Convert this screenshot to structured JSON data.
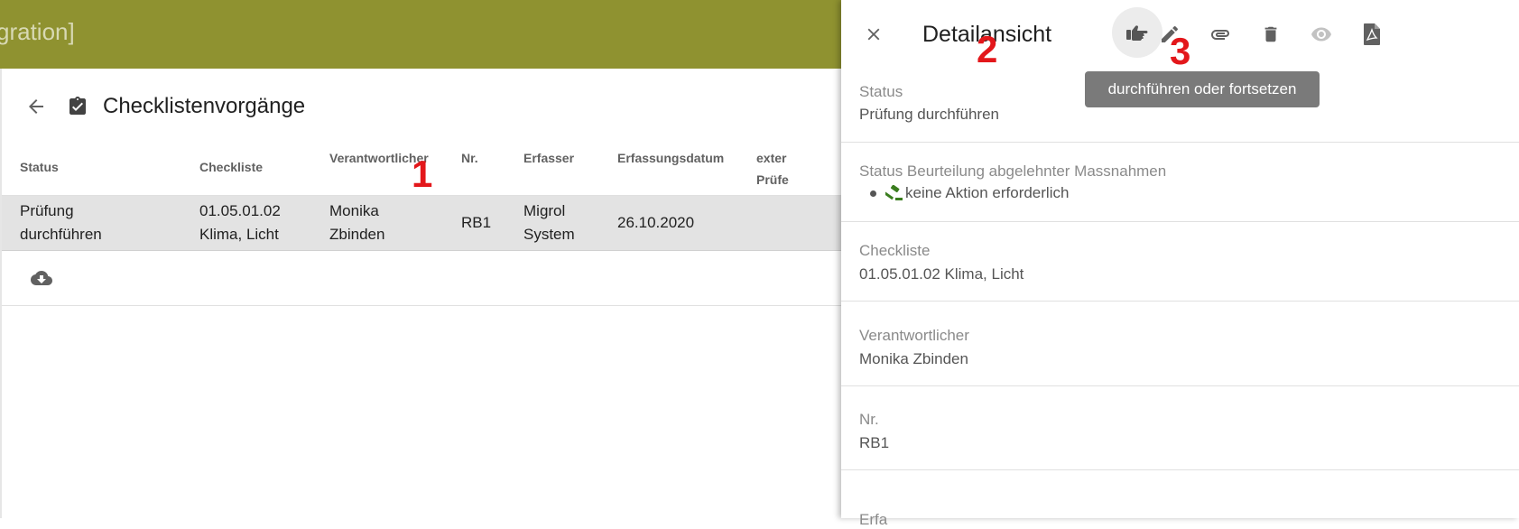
{
  "app": {
    "title_fragment": "gration]"
  },
  "page": {
    "title": "Checklistenvorgänge"
  },
  "table": {
    "headers": {
      "status": "Status",
      "checkliste": "Checkliste",
      "verantwortlicher": "Verantwortlicher",
      "nr": "Nr.",
      "erfasser": "Erfasser",
      "erfassungsdatum": "Erfassungsdatum",
      "extern_line1": "exter",
      "extern_line2": "Prüfe"
    },
    "row": {
      "status_line1": "Prüfung",
      "status_line2": "durchführen",
      "checkliste_line1": "01.05.01.02",
      "checkliste_line2": "Klima, Licht",
      "verantwortlicher_line1": "Monika",
      "verantwortlicher_line2": "Zbinden",
      "nr": "RB1",
      "erfasser_line1": "Migrol",
      "erfasser_line2": "System",
      "erfassungsdatum": "26.10.2020"
    }
  },
  "markers": {
    "m1": "1",
    "m2": "2",
    "m3": "3"
  },
  "detail": {
    "title": "Detailansicht",
    "tooltip": "durchführen oder fortsetzen",
    "status": {
      "label": "Status",
      "value": "Prüfung durchführen"
    },
    "beurteilung": {
      "label": "Status Beurteilung abgelehnter Massnahmen",
      "value": "keine Aktion erforderlich"
    },
    "checkliste": {
      "label": "Checkliste",
      "value": "01.05.01.02 Klima, Licht"
    },
    "verantwortlicher": {
      "label": "Verantwortlicher",
      "value": "Monika Zbinden"
    },
    "nr": {
      "label": "Nr.",
      "value": "RB1"
    },
    "erfasser_partial": {
      "label": "Erfa"
    }
  },
  "colors": {
    "topbar": "#8f9230",
    "marker": "#e3171b",
    "tooltip": "#7a7a7a"
  },
  "icons": [
    "arrow-back-icon",
    "clipboard-check-icon",
    "cloud-download-icon",
    "close-icon",
    "pointing-hand-icon",
    "pencil-icon",
    "paperclip-icon",
    "trash-icon",
    "eye-icon",
    "pdf-icon",
    "gavel-icon"
  ]
}
